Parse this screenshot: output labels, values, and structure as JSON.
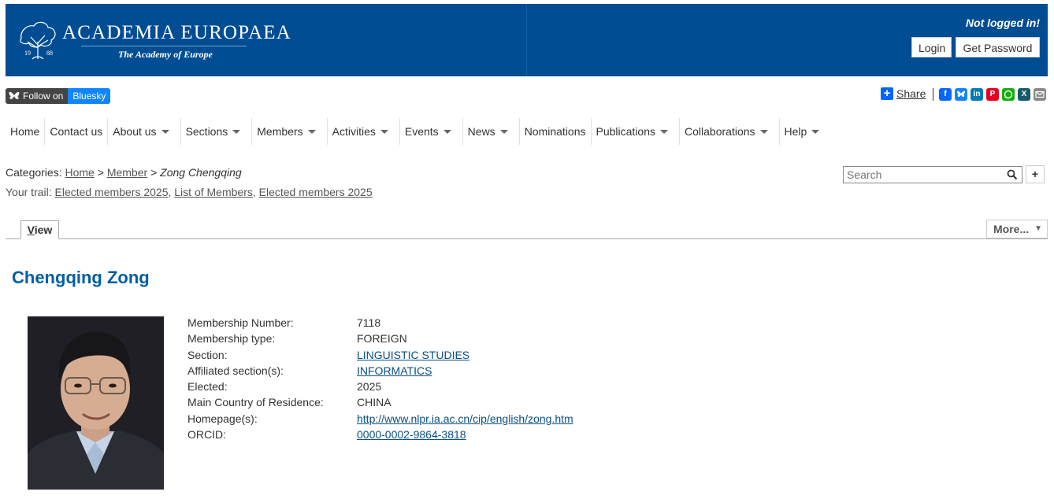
{
  "header": {
    "logo_title": "ACADEMIA EUROPAEA",
    "logo_subtitle": "The Academy of Europe",
    "logo_year_left": "19",
    "logo_year_right": "88",
    "status_text": "Not logged in!",
    "login_label": "Login",
    "get_password_label": "Get Password",
    "brand_color": "#004d93"
  },
  "social": {
    "bluesky_follow": "Follow on",
    "bluesky_name": "Bluesky",
    "share_label": "Share",
    "icons": [
      "facebook-icon",
      "bluesky-icon",
      "linkedin-icon",
      "pinterest-icon",
      "whatsapp-icon",
      "xing-icon",
      "email-icon"
    ]
  },
  "nav": {
    "items": [
      {
        "label": "Home",
        "dropdown": false
      },
      {
        "label": "Contact us",
        "dropdown": false
      },
      {
        "label": "About us",
        "dropdown": true
      },
      {
        "label": "Sections",
        "dropdown": true
      },
      {
        "label": "Members",
        "dropdown": true
      },
      {
        "label": "Activities",
        "dropdown": true
      },
      {
        "label": "Events",
        "dropdown": true
      },
      {
        "label": "News",
        "dropdown": true
      },
      {
        "label": "Nominations",
        "dropdown": false
      },
      {
        "label": "Publications",
        "dropdown": true
      },
      {
        "label": "Collaborations",
        "dropdown": true
      },
      {
        "label": "Help",
        "dropdown": true
      }
    ]
  },
  "breadcrumb": {
    "prefix": "Categories:",
    "home": "Home",
    "sep": ">",
    "member": "Member",
    "current": "Zong Chengqing"
  },
  "trail": {
    "prefix": "Your trail:",
    "items": [
      "Elected members 2025",
      "List of Members",
      "Elected members 2025"
    ]
  },
  "search": {
    "placeholder": "Search"
  },
  "tabs": {
    "view_first": "V",
    "view_rest": "iew",
    "more": "More...",
    "more_arrow": "▼"
  },
  "profile": {
    "name": "Chengqing Zong",
    "rows": [
      {
        "label": "Membership Number:",
        "value": "7118",
        "link": false
      },
      {
        "label": "Membership type:",
        "value": "FOREIGN",
        "link": false
      },
      {
        "label": "Section:",
        "value": "LINGUISTIC STUDIES",
        "link": true
      },
      {
        "label": "Affiliated section(s):",
        "value": "INFORMATICS",
        "link": true
      },
      {
        "label": "Elected:",
        "value": "2025",
        "link": false
      },
      {
        "label": "Main Country of Residence:",
        "value": "CHINA",
        "link": false
      },
      {
        "label": "Homepage(s):",
        "value": "http://www.nlpr.ia.ac.cn/cip/english/zong.htm",
        "link": true
      },
      {
        "label": "ORCID:",
        "value": "0000-0002-9864-3818",
        "link": true
      }
    ]
  }
}
